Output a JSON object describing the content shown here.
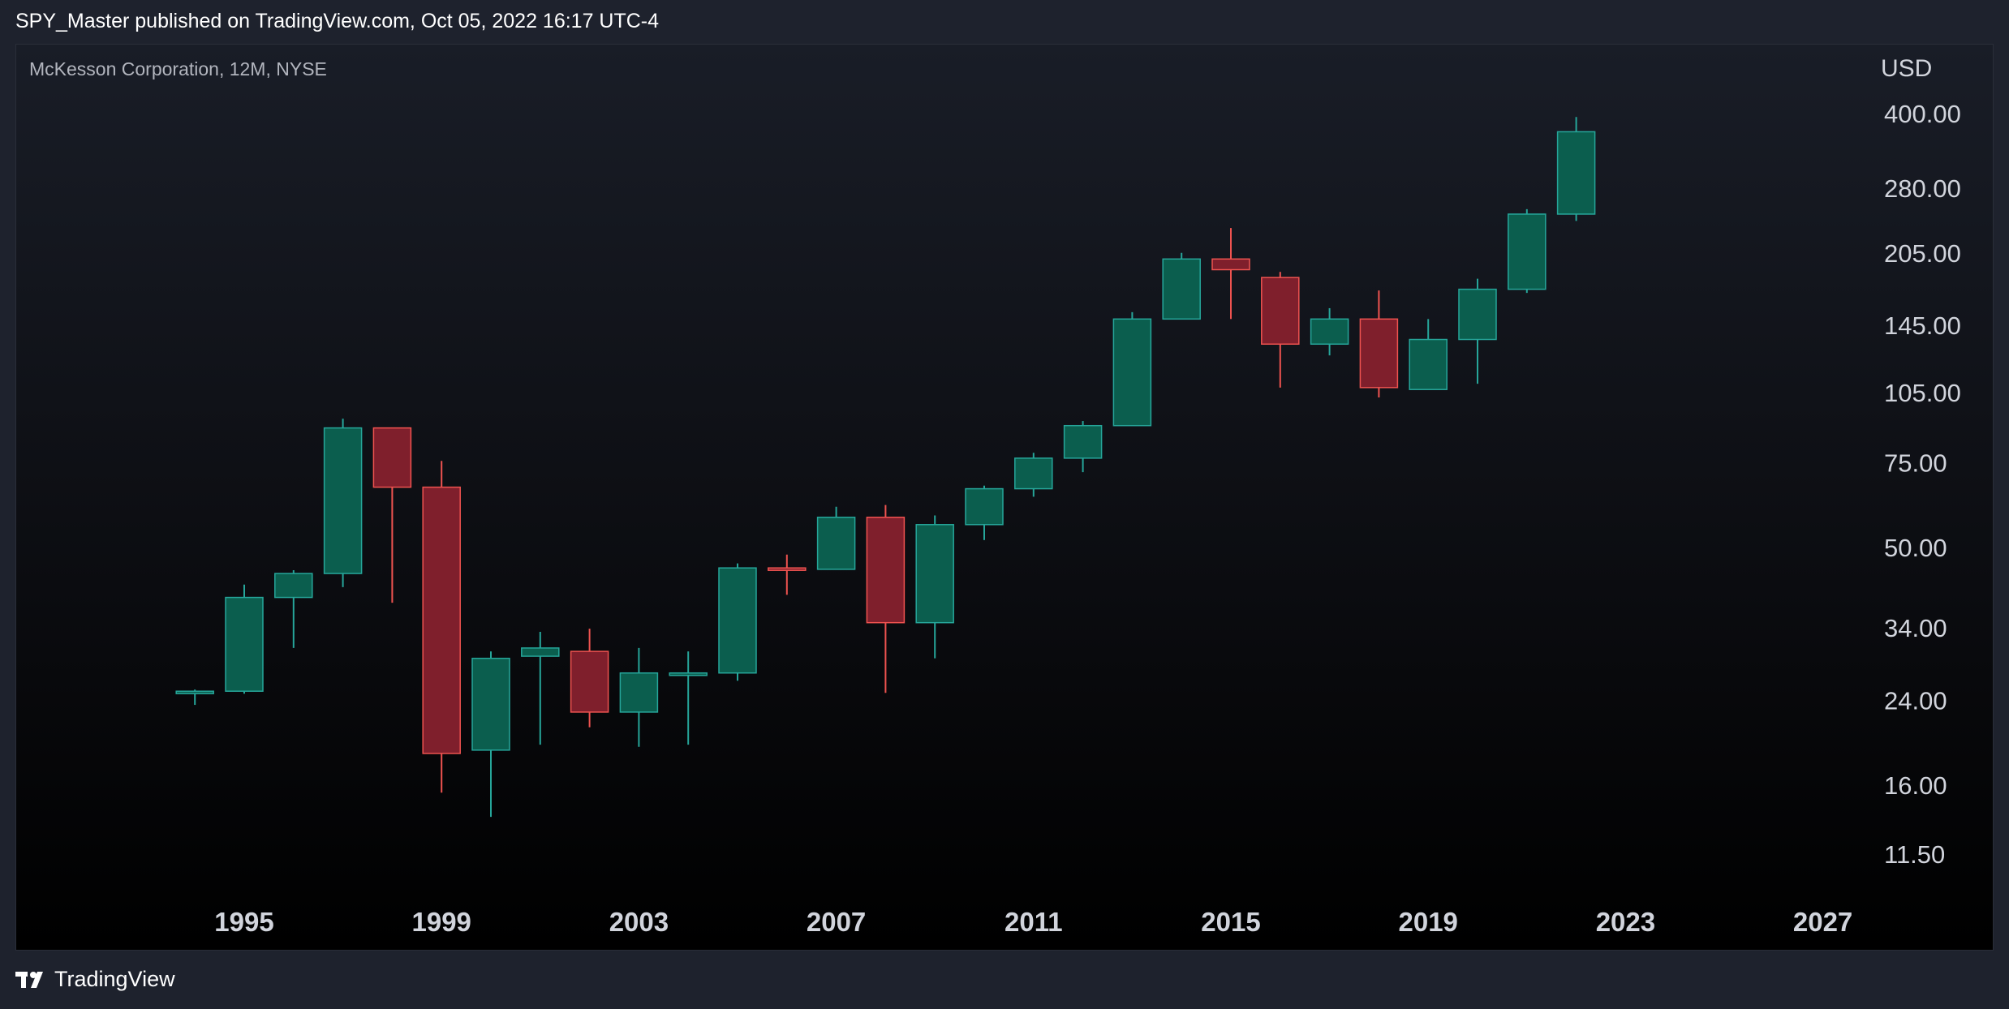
{
  "header": {
    "publisher_line": "SPY_Master published on TradingView.com, Oct 05, 2022 16:17 UTC-4"
  },
  "footer": {
    "brand": "TradingView"
  },
  "chart_data": {
    "type": "candlestick",
    "title": "McKesson Corporation, 12M, NYSE",
    "currency": "USD",
    "scale": "log",
    "grid": false,
    "ylim": [
      9.5,
      440
    ],
    "xlim": [
      1991.5,
      2028
    ],
    "y_ticks": [
      400,
      280,
      205,
      145,
      105,
      75,
      50,
      34,
      24,
      16,
      11.5
    ],
    "y_tick_labels": [
      "400.00",
      "280.00",
      "205.00",
      "145.00",
      "105.00",
      "75.00",
      "50.00",
      "34.00",
      "24.00",
      "16.00",
      "11.50"
    ],
    "x_ticks": [
      1995,
      1999,
      2003,
      2007,
      2011,
      2015,
      2019,
      2023,
      2027
    ],
    "colors": {
      "up": "#0b5e4e",
      "up_border": "#26a69a",
      "down": "#7f1f2c",
      "down_border": "#ef5350"
    },
    "candles": [
      {
        "year": 1994,
        "open": 25.0,
        "high": 25.4,
        "low": 23.6,
        "close": 25.2
      },
      {
        "year": 1995,
        "open": 25.2,
        "high": 42.0,
        "low": 24.9,
        "close": 39.5
      },
      {
        "year": 1996,
        "open": 39.5,
        "high": 45.0,
        "low": 31.0,
        "close": 44.3
      },
      {
        "year": 1997,
        "open": 44.3,
        "high": 93.0,
        "low": 41.5,
        "close": 89.0
      },
      {
        "year": 1998,
        "open": 89.0,
        "high": 89.0,
        "low": 38.5,
        "close": 67.0
      },
      {
        "year": 1999,
        "open": 67.0,
        "high": 76.0,
        "low": 15.5,
        "close": 18.7
      },
      {
        "year": 2000,
        "open": 19.0,
        "high": 30.5,
        "low": 13.8,
        "close": 29.5
      },
      {
        "year": 2001,
        "open": 29.8,
        "high": 33.5,
        "low": 19.5,
        "close": 31.0
      },
      {
        "year": 2002,
        "open": 30.5,
        "high": 34.0,
        "low": 21.2,
        "close": 22.8
      },
      {
        "year": 2003,
        "open": 22.8,
        "high": 31.0,
        "low": 19.3,
        "close": 27.5
      },
      {
        "year": 2004,
        "open": 27.2,
        "high": 30.5,
        "low": 19.5,
        "close": 27.5
      },
      {
        "year": 2005,
        "open": 27.5,
        "high": 46.5,
        "low": 26.5,
        "close": 45.5
      },
      {
        "year": 2006,
        "open": 45.5,
        "high": 48.5,
        "low": 40.0,
        "close": 45.2
      },
      {
        "year": 2007,
        "open": 45.2,
        "high": 61.0,
        "low": 45.2,
        "close": 58.0
      },
      {
        "year": 2008,
        "open": 58.0,
        "high": 61.5,
        "low": 25.0,
        "close": 35.0
      },
      {
        "year": 2009,
        "open": 35.0,
        "high": 58.5,
        "low": 29.5,
        "close": 56.0
      },
      {
        "year": 2010,
        "open": 56.0,
        "high": 67.5,
        "low": 52.0,
        "close": 66.5
      },
      {
        "year": 2011,
        "open": 66.5,
        "high": 79.0,
        "low": 64.0,
        "close": 77.0
      },
      {
        "year": 2012,
        "open": 77.0,
        "high": 92.0,
        "low": 72.0,
        "close": 90.0
      },
      {
        "year": 2013,
        "open": 90.0,
        "high": 155.0,
        "low": 90.0,
        "close": 150.0
      },
      {
        "year": 2014,
        "open": 150.0,
        "high": 206.0,
        "low": 150.0,
        "close": 200.0
      },
      {
        "year": 2015,
        "open": 200.0,
        "high": 232.0,
        "low": 150.0,
        "close": 190.0
      },
      {
        "year": 2016,
        "open": 183.0,
        "high": 188.0,
        "low": 108.0,
        "close": 133.0
      },
      {
        "year": 2017,
        "open": 133.0,
        "high": 158.0,
        "low": 126.0,
        "close": 150.0
      },
      {
        "year": 2018,
        "open": 150.0,
        "high": 172.0,
        "low": 103.0,
        "close": 108.0
      },
      {
        "year": 2019,
        "open": 107.0,
        "high": 150.0,
        "low": 107.0,
        "close": 136.0
      },
      {
        "year": 2020,
        "open": 136.0,
        "high": 182.0,
        "low": 110.0,
        "close": 173.0
      },
      {
        "year": 2021,
        "open": 173.0,
        "high": 254.0,
        "low": 170.0,
        "close": 248.0
      },
      {
        "year": 2022,
        "open": 248.0,
        "high": 395.0,
        "low": 240.0,
        "close": 368.0
      }
    ]
  }
}
